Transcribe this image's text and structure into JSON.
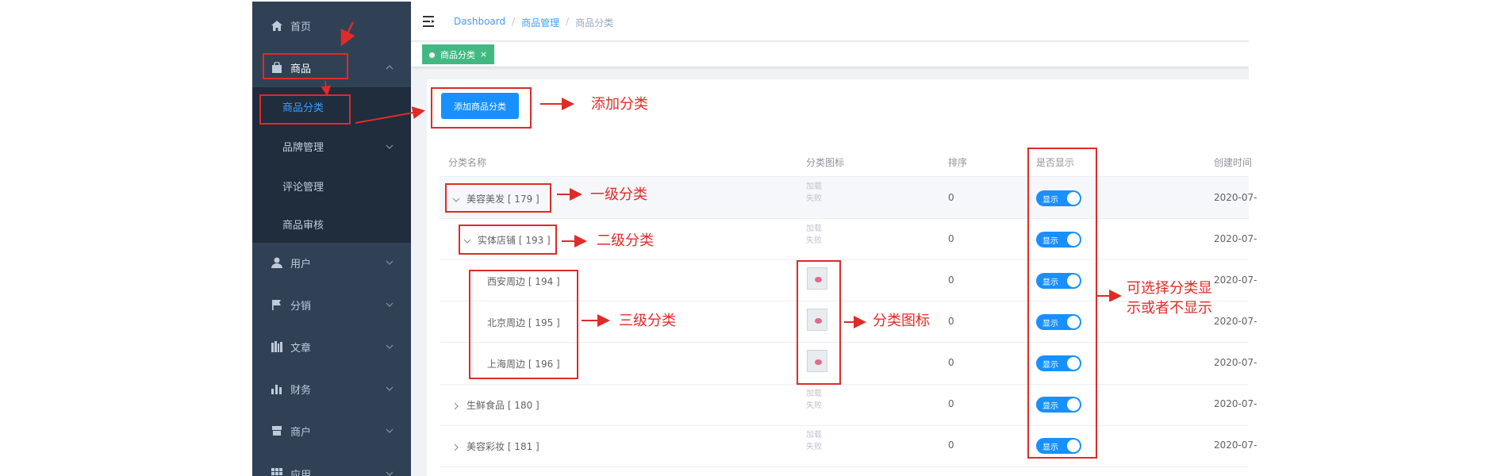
{
  "sidebar": {
    "home": "首页",
    "goods": "商品",
    "goods_children": [
      "商品分类",
      "品牌管理",
      "评论管理",
      "商品审核"
    ],
    "user": "用户",
    "distribution": "分销",
    "article": "文章",
    "finance": "财务",
    "merchant": "商户",
    "application": "应用"
  },
  "breadcrumb": {
    "dashboard": "Dashboard",
    "goods_manage": "商品管理",
    "current": "商品分类",
    "separator": "/"
  },
  "tags": {
    "active": "商品分类",
    "close": "×"
  },
  "toolbar": {
    "add_label": "添加商品分类"
  },
  "table": {
    "headers": {
      "name": "分类名称",
      "icon": "分类图标",
      "sort": "排序",
      "show": "是否显示",
      "created": "创建时间"
    },
    "icon_placeholder_line1": "加载",
    "icon_placeholder_line2": "失败",
    "switch_label": "显示",
    "rows": [
      {
        "name": "美容美发 [ 179 ]",
        "sort": "0",
        "date": "2020-07-",
        "level": 1,
        "expanded": true
      },
      {
        "name": "实体店铺 [ 193 ]",
        "sort": "0",
        "date": "2020-07-",
        "level": 2,
        "expanded": true
      },
      {
        "name": "西安周边 [ 194 ]",
        "sort": "0",
        "date": "2020-07-",
        "level": 3
      },
      {
        "name": "北京周边 [ 195 ]",
        "sort": "0",
        "date": "2020-07-",
        "level": 3
      },
      {
        "name": "上海周边 [ 196 ]",
        "sort": "0",
        "date": "2020-07-",
        "level": 3
      },
      {
        "name": "生鲜食品 [ 180 ]",
        "sort": "0",
        "date": "2020-07-",
        "level": 1,
        "expanded": false
      },
      {
        "name": "美容彩妆 [ 181 ]",
        "sort": "0",
        "date": "2020-07-",
        "level": 1,
        "expanded": false
      }
    ]
  },
  "annotations": {
    "add_category": "添加分类",
    "level1": "一级分类",
    "level2": "二级分类",
    "level3": "三级分类",
    "category_icon": "分类图标",
    "show_toggle_line1": "可选择分类显",
    "show_toggle_line2": "示或者不显示"
  },
  "colors": {
    "sidebar_bg": "#304156",
    "submenu_bg": "#1f2d3d",
    "accent": "#1890ff",
    "tag_green": "#42b983",
    "annotation_red": "#e02b27"
  }
}
